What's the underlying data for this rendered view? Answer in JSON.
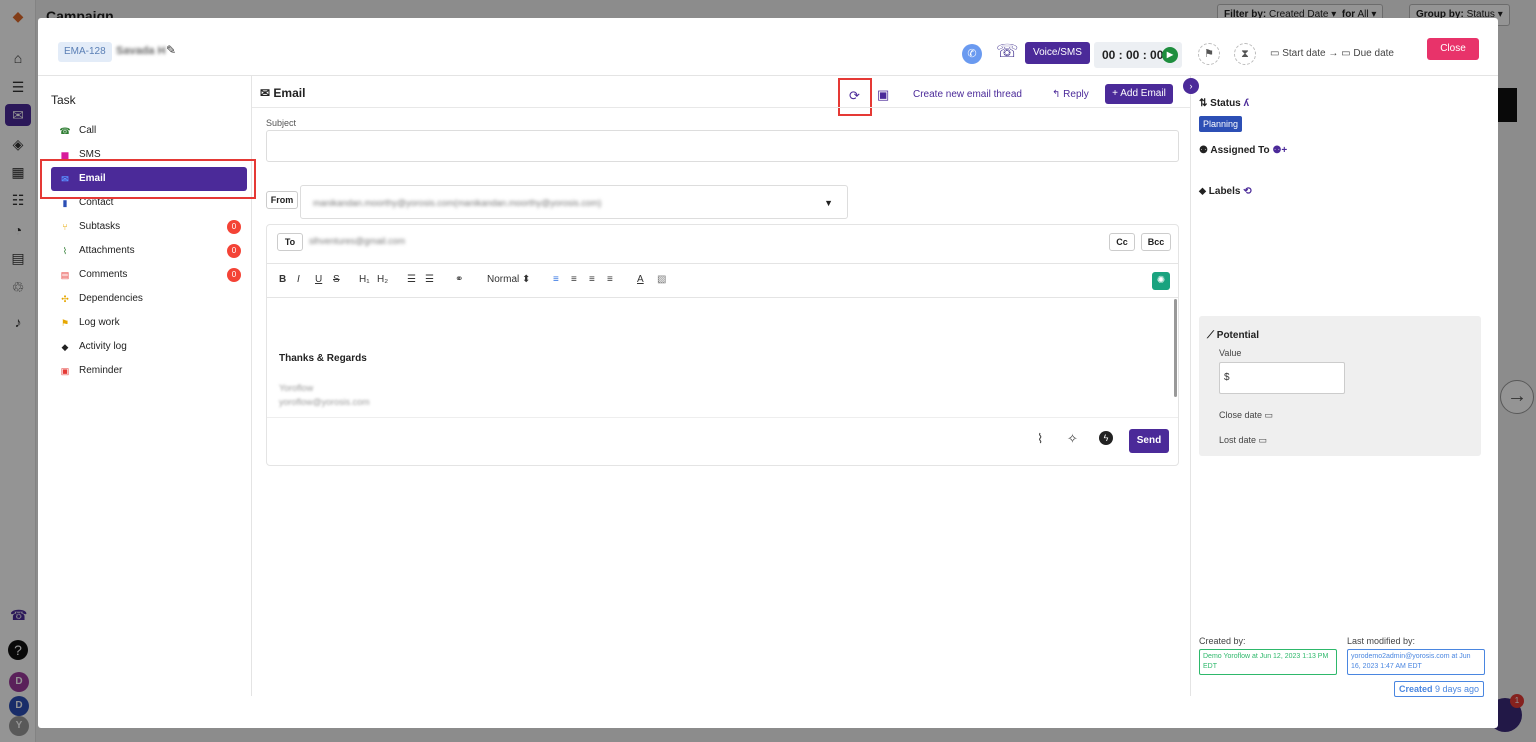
{
  "background": {
    "app_title": "Campaign",
    "filter_label": "Filter by:",
    "filter_value": "Created Date",
    "for_label": "for",
    "for_value": "All",
    "group_label": "Group by:",
    "group_value": "Status",
    "avatars": [
      "D",
      "D",
      "Y"
    ]
  },
  "modal": {
    "task_id": "EMA-128",
    "task_name": "Savada H",
    "voice_sms": "Voice/SMS",
    "timer": "00 : 00 : 00",
    "start_date": "Start date",
    "arrow": "→",
    "due_date": "Due date",
    "close": "Close"
  },
  "sidebar": {
    "title": "Task",
    "items": [
      {
        "label": "Call",
        "icon": "phone-icon",
        "color": "#2e7d32"
      },
      {
        "label": "SMS",
        "icon": "sms-icon",
        "color": "#d81b9b"
      },
      {
        "label": "Email",
        "icon": "email-icon",
        "color": "#4b2a99",
        "active": true
      },
      {
        "label": "Contact",
        "icon": "contact-icon",
        "color": "#2c4fb5"
      },
      {
        "label": "Subtasks",
        "icon": "subtasks-icon",
        "color": "#e6a700",
        "badge": "0"
      },
      {
        "label": "Attachments",
        "icon": "attachment-icon",
        "color": "#2e7d32",
        "badge": "0"
      },
      {
        "label": "Comments",
        "icon": "comment-icon",
        "color": "#e53935",
        "badge": "0"
      },
      {
        "label": "Dependencies",
        "icon": "dependencies-icon",
        "color": "#e6a700"
      },
      {
        "label": "Log work",
        "icon": "flag-icon",
        "color": "#e6a700"
      },
      {
        "label": "Activity log",
        "icon": "activity-icon",
        "color": "#222"
      },
      {
        "label": "Reminder",
        "icon": "reminder-icon",
        "color": "#e53935"
      }
    ]
  },
  "email": {
    "title": "Email",
    "create_thread": "Create new email thread",
    "reply": "Reply",
    "add_email": "+ Add Email",
    "subject_label": "Subject",
    "subject_value": "",
    "from_label": "From",
    "from_value": "manikandan.moorthy@yorosis.com(manikandan.moorthy@yorosis.com)",
    "to_label": "To",
    "to_value": "slhventures@gmail.com",
    "cc": "Cc",
    "bcc": "Bcc",
    "toolbar": {
      "bold": "B",
      "italic": "I",
      "underline": "U",
      "strike": "S",
      "h1": "H₁",
      "h2": "H₂",
      "font_size": "Normal ⬍"
    },
    "signature": {
      "title": "Thanks & Regards",
      "line1": "Yoroflow",
      "line2": "yoroflow@yorosis.com"
    },
    "send": "Send"
  },
  "details": {
    "status_label": "Status",
    "status_value": "Planning",
    "assigned_label": "Assigned To",
    "labels_label": "Labels",
    "potential_label": "Potential",
    "value_label": "Value",
    "value_input": "$",
    "close_date": "Close date",
    "lost_date": "Lost date",
    "created_by_label": "Created by:",
    "created_by_value": "Demo Yoroflow at Jun 12, 2023 1:13 PM EDT",
    "last_modified_label": "Last modified by:",
    "last_modified_value": "yorodemo2admin@yorosis.com at Jun 16, 2023 1:47 AM EDT",
    "created_word": "Created",
    "created_ago": "9 days ago"
  }
}
